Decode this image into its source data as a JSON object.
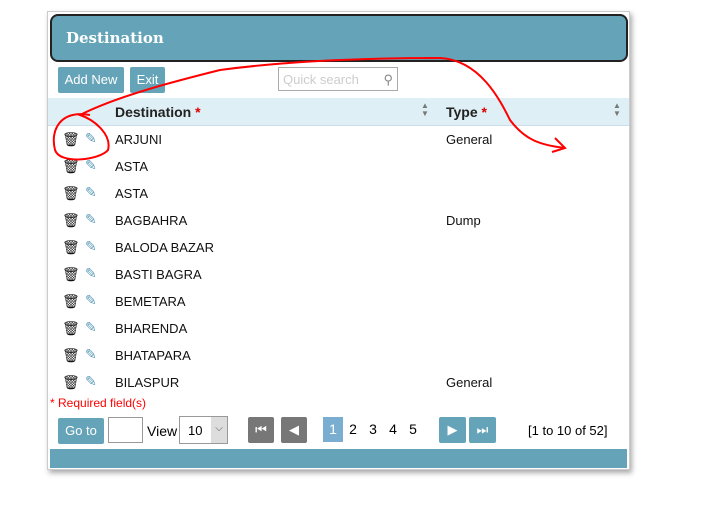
{
  "header": {
    "title": "Destination"
  },
  "toolbar": {
    "add_new": "Add New",
    "exit": "Exit",
    "search_placeholder": "Quick search",
    "search_icon": "magnifier-icon"
  },
  "columns": [
    {
      "label": "Destination",
      "required": "*"
    },
    {
      "label": "Type",
      "required": "*"
    }
  ],
  "rows": [
    {
      "destination": "ARJUNI",
      "type": "General"
    },
    {
      "destination": "ASTA",
      "type": ""
    },
    {
      "destination": "ASTA",
      "type": ""
    },
    {
      "destination": "BAGBAHRA",
      "type": "Dump"
    },
    {
      "destination": "BALODA BAZAR",
      "type": ""
    },
    {
      "destination": "BASTI BAGRA",
      "type": ""
    },
    {
      "destination": "BEMETARA",
      "type": ""
    },
    {
      "destination": "BHARENDA",
      "type": ""
    },
    {
      "destination": "BHATAPARA",
      "type": ""
    },
    {
      "destination": "BILASPUR",
      "type": "General"
    }
  ],
  "required_note": "* Required field(s)",
  "pager": {
    "goto": "Go to",
    "goto_value": "",
    "view_label": "View",
    "view_value": "10",
    "pages": [
      "1",
      "2",
      "3",
      "4",
      "5"
    ],
    "current": "1",
    "summary": "[1 to 10 of 52]"
  },
  "colors": {
    "accent": "#65a4b8",
    "annotation": "#ff0000"
  }
}
